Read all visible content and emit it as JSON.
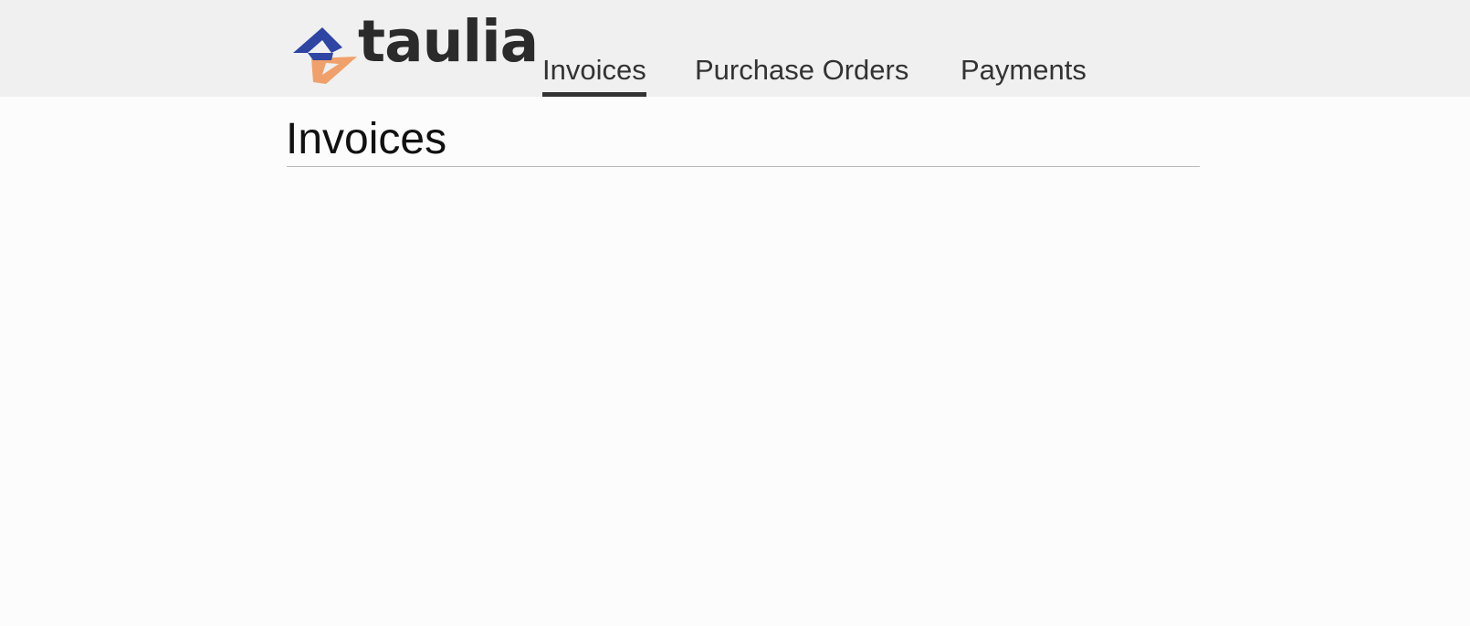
{
  "header": {
    "logo_text": "taulia",
    "logo_colors": {
      "blue": "#2f45a3",
      "orange": "#f0a06a"
    },
    "nav": [
      {
        "label": "Invoices",
        "active": true
      },
      {
        "label": "Purchase Orders",
        "active": false
      },
      {
        "label": "Payments",
        "active": false
      }
    ]
  },
  "main": {
    "title": "Invoices"
  },
  "colors": {
    "header_bg": "#f0f0f0",
    "page_bg": "#fcfcfc",
    "nav_text": "#333333",
    "title_text": "#111111",
    "rule": "#b9b9b9"
  }
}
